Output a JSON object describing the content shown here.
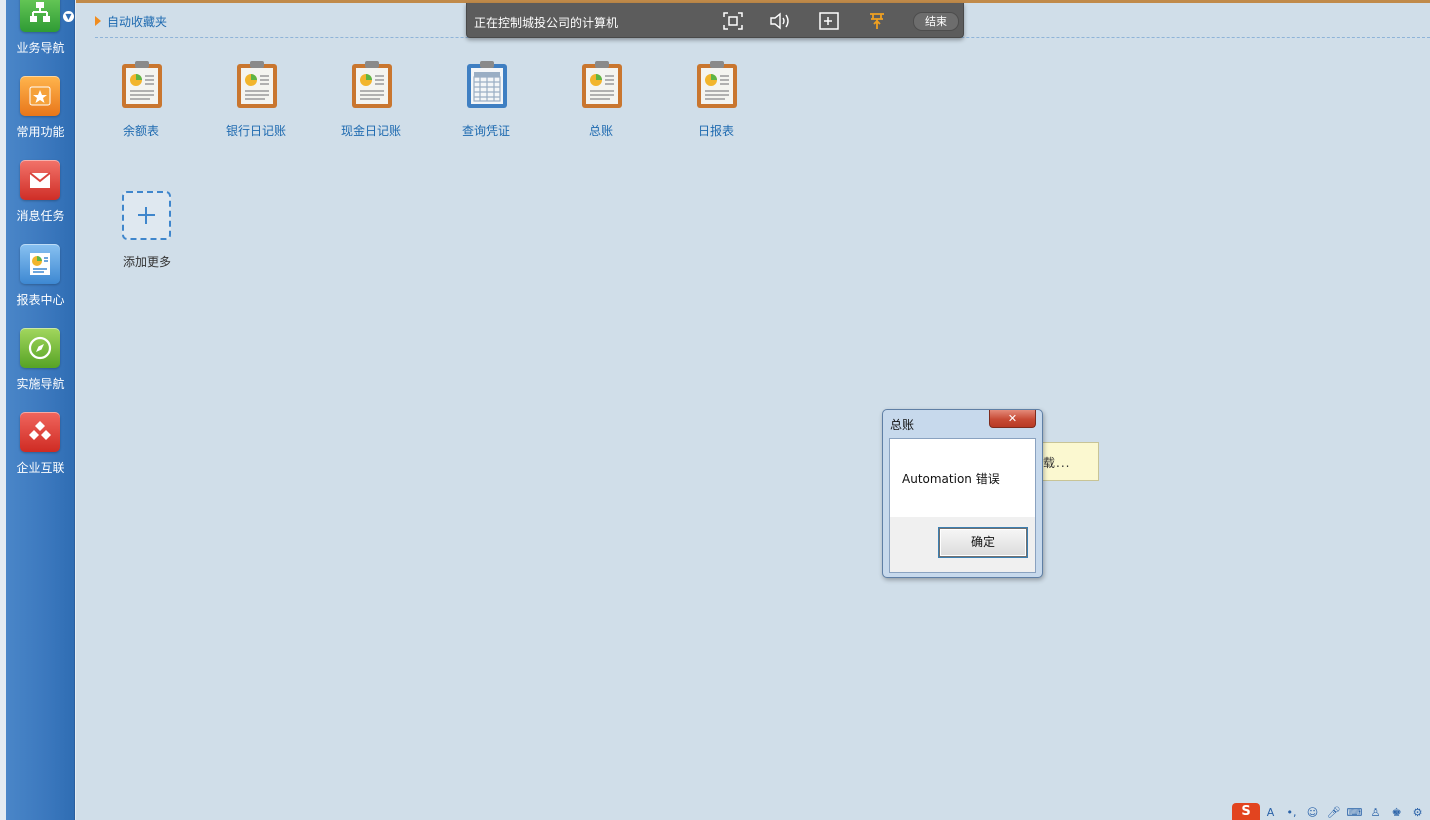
{
  "sidebar": {
    "items": [
      {
        "label": "业务导航",
        "icon": "flowchart-icon",
        "color": "#3aa53a"
      },
      {
        "label": "常用功能",
        "icon": "star-icon",
        "color": "#f08a22"
      },
      {
        "label": "消息任务",
        "icon": "envelope-icon",
        "color": "#d9433b"
      },
      {
        "label": "报表中心",
        "icon": "report-icon",
        "color": "#3f8fd6"
      },
      {
        "label": "实施导航",
        "icon": "compass-icon",
        "color": "#62ad2f"
      },
      {
        "label": "企业互联",
        "icon": "network-icon",
        "color": "#dd3f35"
      }
    ]
  },
  "favorites": {
    "title": "自动收藏夹",
    "shortcuts": [
      {
        "label": "余额表",
        "icon": "clipboard-chart-icon"
      },
      {
        "label": "银行日记账",
        "icon": "clipboard-chart-icon"
      },
      {
        "label": "现金日记账",
        "icon": "clipboard-chart-icon"
      },
      {
        "label": "查询凭证",
        "icon": "spreadsheet-icon"
      },
      {
        "label": "总账",
        "icon": "clipboard-chart-icon"
      },
      {
        "label": "日报表",
        "icon": "clipboard-chart-icon"
      }
    ],
    "add_more_label": "添加更多"
  },
  "remote_bar": {
    "title": "正在控制城投公司的计算机",
    "end_label": "结束",
    "buttons": [
      "fullscreen-icon",
      "volume-icon",
      "window-resize-icon",
      "pin-icon"
    ]
  },
  "loading_tip": {
    "text": "载..."
  },
  "dialog": {
    "title": "总账",
    "close_symbol": "✕",
    "message": "Automation 错误",
    "ok_label": "确定"
  },
  "ime": {
    "logo": "S"
  },
  "colors": {
    "sidebar_rail": "#3b78be",
    "workspace_bg": "#d0dee9",
    "link_blue": "#1e6ab0",
    "accent_orange": "#f08c1e"
  }
}
